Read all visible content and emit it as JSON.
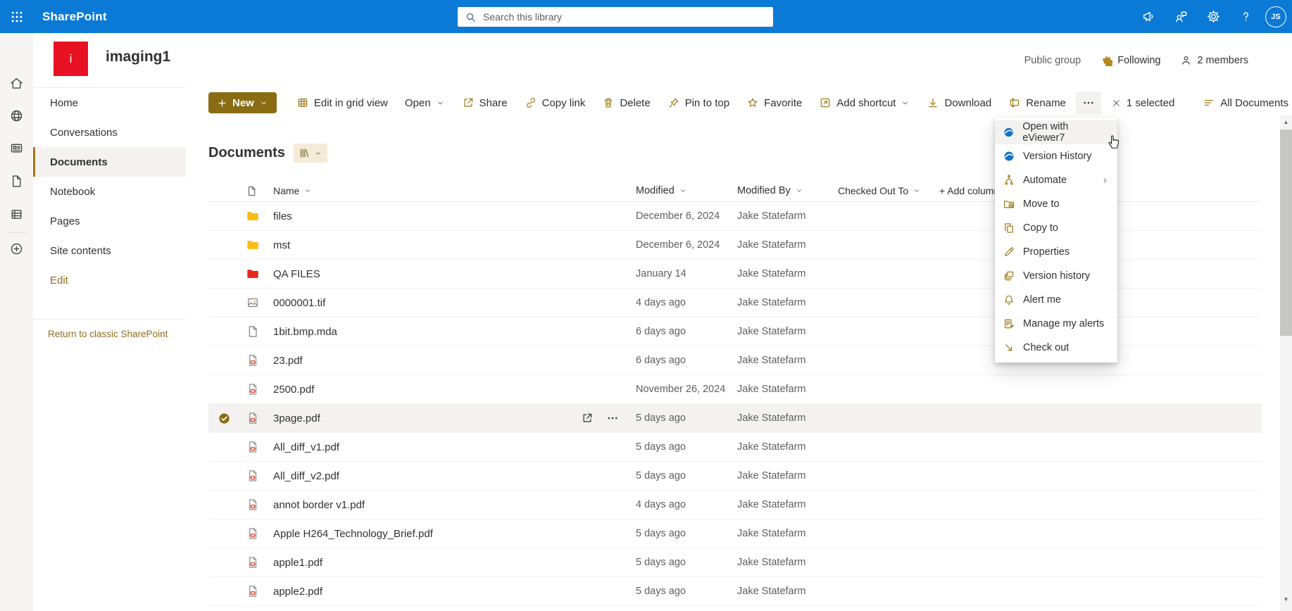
{
  "topbar": {
    "app_name": "SharePoint",
    "search_placeholder": "Search this library",
    "avatar_initials": "JS"
  },
  "site": {
    "title": "imaging1",
    "icon_letter": "i",
    "privacy_label": "Public group",
    "following_label": "Following",
    "members_label": "2 members"
  },
  "sidebar": {
    "items": [
      {
        "label": "Home"
      },
      {
        "label": "Conversations"
      },
      {
        "label": "Documents",
        "selected": true
      },
      {
        "label": "Notebook"
      },
      {
        "label": "Pages"
      },
      {
        "label": "Site contents"
      },
      {
        "label": "Edit"
      }
    ],
    "return_link": "Return to classic SharePoint"
  },
  "toolbar": {
    "new_label": "New",
    "items": [
      {
        "label": "Edit in grid view",
        "icon": "grid-icon"
      },
      {
        "label": "Open",
        "icon": "none",
        "chevron": true
      },
      {
        "label": "Share",
        "icon": "share-icon"
      },
      {
        "label": "Copy link",
        "icon": "link-icon"
      },
      {
        "label": "Delete",
        "icon": "trash-icon"
      },
      {
        "label": "Pin to top",
        "icon": "pin-icon"
      },
      {
        "label": "Favorite",
        "icon": "star-icon"
      },
      {
        "label": "Add shortcut",
        "icon": "shortcut-icon",
        "chevron": true
      },
      {
        "label": "Download",
        "icon": "download-icon"
      },
      {
        "label": "Rename",
        "icon": "rename-icon"
      }
    ],
    "selection_label": "1 selected",
    "view_label": "All Documents"
  },
  "library": {
    "heading": "Documents",
    "columns": {
      "name": "Name",
      "modified": "Modified",
      "modified_by": "Modified By",
      "checked_out_to": "Checked Out To"
    },
    "add_column_label": "+ Add column",
    "rows": [
      {
        "name": "files",
        "type": "folder",
        "modified": "December 6, 2024",
        "modified_by": "Jake Statefarm"
      },
      {
        "name": "mst",
        "type": "folder",
        "modified": "December 6, 2024",
        "modified_by": "Jake Statefarm"
      },
      {
        "name": "QA FILES",
        "type": "folder-red",
        "modified": "January 14",
        "modified_by": "Jake Statefarm"
      },
      {
        "name": "0000001.tif",
        "type": "image",
        "modified": "4 days ago",
        "modified_by": "Jake Statefarm"
      },
      {
        "name": "1bit.bmp.mda",
        "type": "file",
        "modified": "6 days ago",
        "modified_by": "Jake Statefarm"
      },
      {
        "name": "23.pdf",
        "type": "pdf",
        "modified": "6 days ago",
        "modified_by": "Jake Statefarm"
      },
      {
        "name": "2500.pdf",
        "type": "pdf",
        "modified": "November 26, 2024",
        "modified_by": "Jake Statefarm"
      },
      {
        "name": "3page.pdf",
        "type": "pdf",
        "modified": "5 days ago",
        "modified_by": "Jake Statefarm",
        "selected": true
      },
      {
        "name": "All_diff_v1.pdf",
        "type": "pdf",
        "modified": "5 days ago",
        "modified_by": "Jake Statefarm"
      },
      {
        "name": "All_diff_v2.pdf",
        "type": "pdf",
        "modified": "5 days ago",
        "modified_by": "Jake Statefarm"
      },
      {
        "name": "annot border v1.pdf",
        "type": "pdf",
        "modified": "4 days ago",
        "modified_by": "Jake Statefarm"
      },
      {
        "name": "Apple H264_Technology_Brief.pdf",
        "type": "pdf",
        "modified": "5 days ago",
        "modified_by": "Jake Statefarm"
      },
      {
        "name": "apple1.pdf",
        "type": "pdf",
        "modified": "5 days ago",
        "modified_by": "Jake Statefarm"
      },
      {
        "name": "apple2.pdf",
        "type": "pdf",
        "modified": "5 days ago",
        "modified_by": "Jake Statefarm"
      }
    ]
  },
  "context_menu": {
    "items": [
      {
        "label": "Open with eViewer7",
        "icon": "eviewer-logo-icon",
        "hovered": true
      },
      {
        "label": "Version History",
        "icon": "eviewer-logo-icon"
      },
      {
        "label": "Automate",
        "icon": "automate-icon",
        "submenu": true
      },
      {
        "label": "Move to",
        "icon": "move-to-icon"
      },
      {
        "label": "Copy to",
        "icon": "copy-to-icon"
      },
      {
        "label": "Properties",
        "icon": "pencil-icon"
      },
      {
        "label": "Version history",
        "icon": "layers-icon"
      },
      {
        "label": "Alert me",
        "icon": "bell-icon"
      },
      {
        "label": "Manage my alerts",
        "icon": "manage-alerts-icon"
      },
      {
        "label": "Check out",
        "icon": "check-out-icon"
      }
    ]
  },
  "colors": {
    "topbar_blue": "#0b79d6",
    "accent_gold": "#8a6c13",
    "icon_gold": "#9a7a16",
    "site_icon_red": "#e81123",
    "folder_yellow": "#fbbc15",
    "folder_red": "#e8281e",
    "pdf_red": "#dd4b3e",
    "selected_row_bg": "#f3f2f1",
    "eviewer_blue": "#1272c8"
  }
}
